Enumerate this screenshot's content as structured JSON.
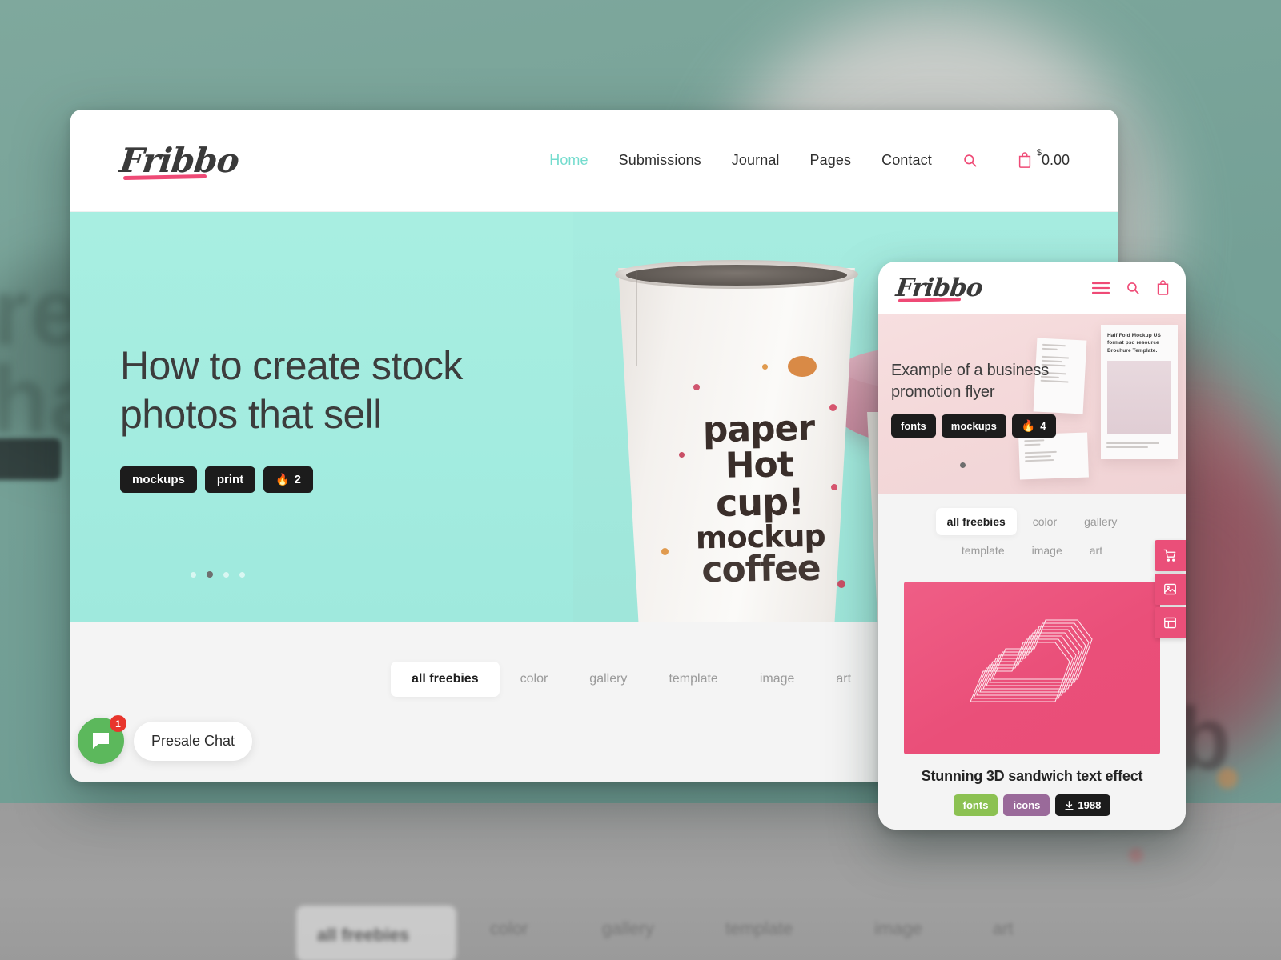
{
  "background": {
    "ghost_words": [
      "rea",
      "hat"
    ],
    "ghost_letter": "b",
    "bottom_card_label": "all freebies",
    "bottom_words": [
      "color",
      "gallery",
      "template",
      "image",
      "art"
    ]
  },
  "desktop": {
    "brand": {
      "name": "Fribbo",
      "accent_color": "#ef4a76"
    },
    "nav": {
      "items": [
        {
          "label": "Home",
          "active": true
        },
        {
          "label": "Submissions",
          "active": false
        },
        {
          "label": "Journal",
          "active": false
        },
        {
          "label": "Pages",
          "active": false
        },
        {
          "label": "Contact",
          "active": false
        }
      ],
      "search_icon": "search-icon",
      "cart_icon": "shopping-bag-icon",
      "cart_currency": "$",
      "cart_amount": "0.00"
    },
    "hero": {
      "title": "How to create stock photos that sell",
      "tags": [
        {
          "label": "mockups",
          "icon": null
        },
        {
          "label": "print",
          "icon": null
        },
        {
          "label": "2",
          "icon": "flame-icon"
        }
      ],
      "background_color": "#a3ece0",
      "photo_text": [
        "paper",
        "Hot",
        "cup!",
        "mockup",
        "coffee"
      ],
      "carousel": {
        "total": 4,
        "active_index": 1
      }
    },
    "filters": [
      {
        "label": "all freebies",
        "active": true
      },
      {
        "label": "color",
        "active": false
      },
      {
        "label": "gallery",
        "active": false
      },
      {
        "label": "template",
        "active": false
      },
      {
        "label": "image",
        "active": false
      },
      {
        "label": "art",
        "active": false
      }
    ],
    "chat": {
      "label": "Presale Chat",
      "badge_count": "1",
      "button_color": "#5cb85c",
      "badge_color": "#e8352c",
      "icon": "chat-bubble-icon"
    }
  },
  "mobile": {
    "brand": {
      "name": "Fribbo"
    },
    "header_icons": [
      "hamburger-menu-icon",
      "search-icon",
      "shopping-bag-icon"
    ],
    "hero": {
      "title": "Example of a business promotion flyer",
      "tags": [
        {
          "label": "fonts",
          "icon": null
        },
        {
          "label": "mockups",
          "icon": null
        },
        {
          "label": "4",
          "icon": "flame-icon"
        }
      ],
      "background_color": "#f4d9da",
      "flyer_caption": "Half Fold Mockup US format psd resource Brochure Template."
    },
    "filters": [
      {
        "label": "all freebies",
        "active": true
      },
      {
        "label": "color",
        "active": false
      },
      {
        "label": "gallery",
        "active": false
      },
      {
        "label": "template",
        "active": false
      },
      {
        "label": "image",
        "active": false
      },
      {
        "label": "art",
        "active": false
      }
    ],
    "card": {
      "title": "Stunning 3D sandwich text effect",
      "thumb_color": "#ea4f79",
      "tags": [
        {
          "label": "fonts",
          "style": "green",
          "icon": null
        },
        {
          "label": "icons",
          "style": "purple",
          "icon": null
        },
        {
          "label": "1988",
          "style": "dark",
          "icon": "download-icon"
        }
      ]
    }
  },
  "side_tabs": [
    {
      "icon": "cart-icon"
    },
    {
      "icon": "image-icon"
    },
    {
      "icon": "layout-icon"
    }
  ]
}
